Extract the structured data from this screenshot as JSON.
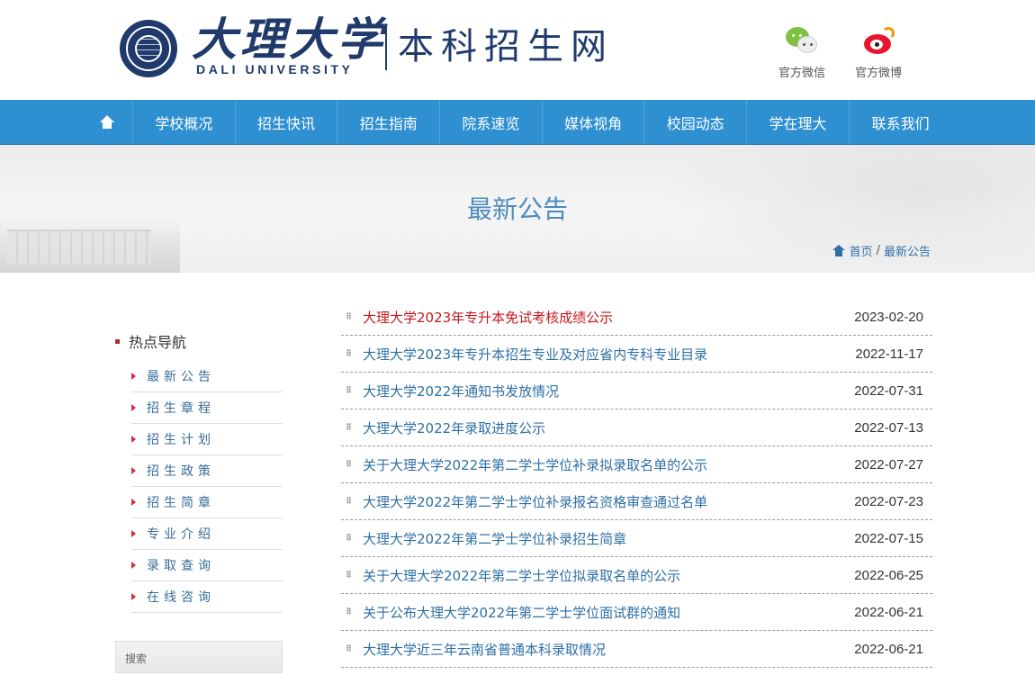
{
  "header": {
    "logo_cn": "大理大学",
    "logo_en": "DALI UNIVERSITY",
    "site_name": "本科招生网",
    "social": [
      {
        "label": "官方微信",
        "icon": "wechat-icon"
      },
      {
        "label": "官方微博",
        "icon": "weibo-icon"
      }
    ]
  },
  "nav": {
    "home_icon": "home-icon",
    "items": [
      "学校概况",
      "招生快讯",
      "招生指南",
      "院系速览",
      "媒体视角",
      "校园动态",
      "学在理大",
      "联系我们"
    ]
  },
  "banner": {
    "title": "最新公告",
    "breadcrumb": {
      "home": "首页",
      "separator": "/",
      "current": "最新公告"
    }
  },
  "sidebar": {
    "title": "热点导航",
    "items": [
      "最新公告",
      "招生章程",
      "招生计划",
      "招生政策",
      "招生简章",
      "专业介绍",
      "录取查询",
      "在线咨询"
    ],
    "search_placeholder": "搜索"
  },
  "news": [
    {
      "title": "大理大学2023年专升本免试考核成绩公示",
      "date": "2023-02-20",
      "highlight": true
    },
    {
      "title": "大理大学2023年专升本招生专业及对应省内专科专业目录",
      "date": "2022-11-17"
    },
    {
      "title": "大理大学2022年通知书发放情况",
      "date": "2022-07-31"
    },
    {
      "title": "大理大学2022年录取进度公示",
      "date": "2022-07-13"
    },
    {
      "title": "关于大理大学2022年第二学士学位补录拟录取名单的公示",
      "date": "2022-07-27"
    },
    {
      "title": "大理大学2022年第二学士学位补录报名资格审查通过名单",
      "date": "2022-07-23"
    },
    {
      "title": "大理大学2022年第二学士学位补录招生简章",
      "date": "2022-07-15"
    },
    {
      "title": "关于大理大学2022年第二学士学位拟录取名单的公示",
      "date": "2022-06-25"
    },
    {
      "title": "关于公布大理大学2022年第二学士学位面试群的通知",
      "date": "2022-06-21"
    },
    {
      "title": "大理大学近三年云南省普通本科录取情况",
      "date": "2022-06-21"
    }
  ],
  "colors": {
    "nav_bg": "#2e8fd1",
    "brand_navy": "#1f3a6b",
    "link_blue": "#2e6fa6",
    "highlight_red": "#c8161d"
  }
}
